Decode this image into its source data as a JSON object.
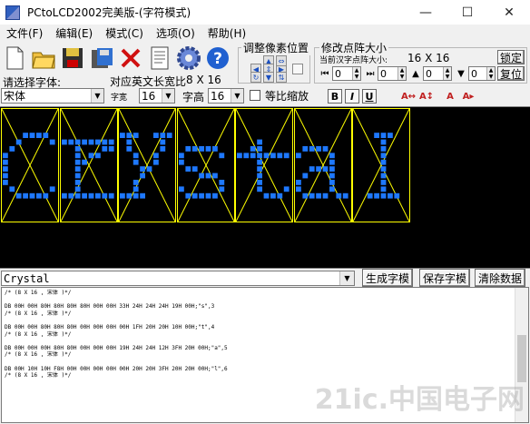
{
  "window": {
    "title": "PCtoLCD2002完美版-(字符模式)",
    "minimize": "—",
    "maximize": "☐",
    "close": "✕"
  },
  "menu": [
    "文件(F)",
    "编辑(E)",
    "模式(C)",
    "选项(O)",
    "帮助(H)"
  ],
  "font_select": {
    "label": "请选择字体:",
    "value": "宋体"
  },
  "char_info": {
    "prefix": "对应英文长宽比",
    "ratio": "8 X 16"
  },
  "char_width": {
    "label": "字宽",
    "value": "16"
  },
  "char_height": {
    "label": "字高",
    "value": "16"
  },
  "proportional": {
    "label": "等比缩放",
    "checked": false
  },
  "format_buttons": [
    "B",
    "I",
    "U"
  ],
  "adjust_group": {
    "title": "调整像素位置"
  },
  "resize_group": {
    "title": "修改点阵大小",
    "current_label": "当前汉字点阵大小:",
    "current_value": "16 X 16",
    "lock": "锁定",
    "reset": "复位",
    "spin_values": [
      "0",
      "0",
      "0",
      "0"
    ]
  },
  "text_input": {
    "value": "Crystal"
  },
  "buttons": {
    "generate": "生成字模",
    "save": "保存字模",
    "clear": "清除数据"
  },
  "output_lines": [
    "/* (8 X 16 , 宋体 )*/",
    "",
    "DB 00H 00H 80H 80H 80H 80H 00H 00H 33H 24H 24H 24H 19H 00H;\"s\",3",
    "/* (8 X 16 , 宋体 )*/",
    "",
    "DB 00H 00H 80H 80H 80H 00H 00H 00H 00H 1FH 20H 20H 10H 00H;\"t\",4",
    "/* (8 X 16 , 宋体 )*/",
    "",
    "DB 00H 00H 00H 80H 80H 00H 00H 00H 19H 24H 24H 12H 3FH 20H 00H;\"a\",5",
    "/* (8 X 16 , 宋体 )*/",
    "",
    "DB 00H 10H 10H F8H 00H 00H 00H 00H 00H 20H 20H 3FH 20H 20H 00H;\"l\",6",
    "/* (8 X 16 , 宋体 )*/"
  ],
  "watermark": "21ic.中国电子网",
  "colors": {
    "pixel": "#1e78ff",
    "grid": "#ffff00",
    "canvas": "#000000"
  },
  "glyphs": [
    [
      "...####",
      "..#....#",
      ".#......",
      "#.......",
      "#.......",
      "#.......",
      "#.......",
      "#.......",
      ".#.....#",
      "..#####."
    ],
    [
      "########",
      "..#...##",
      "..#.##..",
      "..##....",
      "..#.....",
      "..#.....",
      "..#.....",
      "..#.....",
      "########"
    ],
    [
      "###..###",
      ".#....#.",
      ".#....#.",
      "..#..#..",
      "..#..#..",
      "...##...",
      "...#....",
      "..#.....",
      "..#.....",
      "####...."
    ],
    [
      ".#####.",
      "#.....#",
      "#......",
      ".##....",
      "...###.",
      "......#",
      "#.....#",
      ".#####."
    ],
    [
      "...#....",
      "..##....",
      "########",
      "...#....",
      "...#....",
      "...#....",
      "...#....",
      "...#...#",
      "....###."
    ],
    [
      ".####...",
      "#....#..",
      ".....#..",
      "..####..",
      ".#...#..",
      "#....#..",
      "#....#..",
      ".####.##"
    ],
    [
      "...###..",
      "....#...",
      "....#...",
      "....#...",
      "....#...",
      "....#...",
      "....#...",
      "....#...",
      "....#...",
      "..#####."
    ]
  ]
}
